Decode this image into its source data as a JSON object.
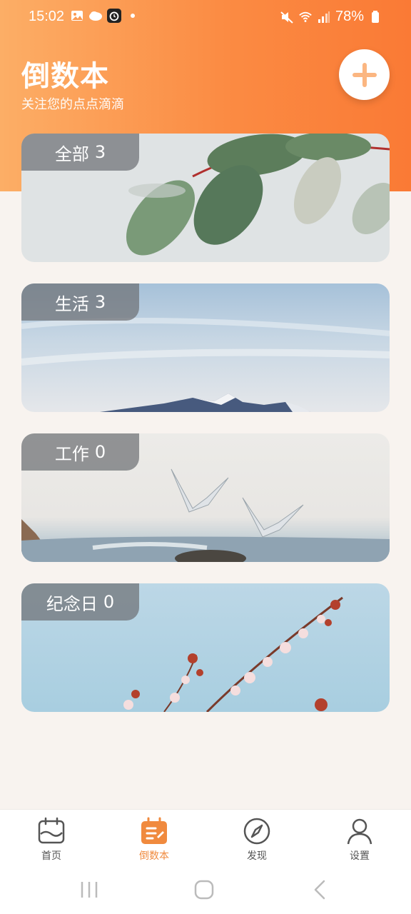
{
  "status_bar": {
    "time": "15:02",
    "battery": "78%",
    "left_icons": [
      "image-icon",
      "cloud-icon",
      "alarm-icon",
      "dot-icon"
    ],
    "right_icons": [
      "mute-icon",
      "wifi-icon",
      "signal-icon",
      "battery-icon"
    ]
  },
  "header": {
    "title": "倒数本",
    "subtitle": "关注您的点点滴滴",
    "add_icon": "plus-icon"
  },
  "categories": [
    {
      "name": "全部",
      "count": "3"
    },
    {
      "name": "生活",
      "count": "3"
    },
    {
      "name": "工作",
      "count": "0"
    },
    {
      "name": "纪念日",
      "count": "0"
    }
  ],
  "bottom_nav": [
    {
      "label": "首页",
      "icon": "calendar-icon",
      "active": false
    },
    {
      "label": "倒数本",
      "icon": "countdown-book-icon",
      "active": true
    },
    {
      "label": "发现",
      "icon": "compass-icon",
      "active": false
    },
    {
      "label": "设置",
      "icon": "user-icon",
      "active": false
    }
  ],
  "system_nav": [
    "recents-icon",
    "home-icon",
    "back-icon"
  ],
  "colors": {
    "accent": "#f08a3e",
    "header_start": "#fcae66",
    "header_end": "#fa7a35",
    "background": "#f8f3ef"
  }
}
